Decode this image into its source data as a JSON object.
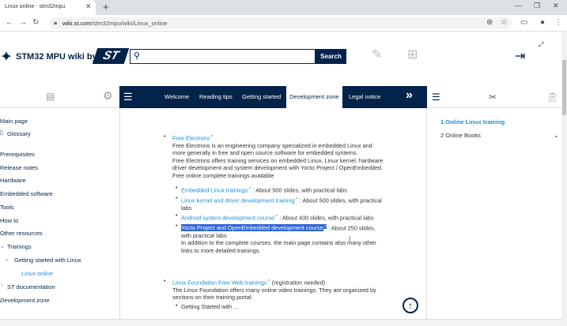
{
  "browser": {
    "tab_title": "Linux online - stm32mpu",
    "url_host": "wiki.st.com",
    "url_path": "/stm32mpu/wiki/Linux_online",
    "new_tab_icon": "plus-icon",
    "close_tab_icon": "close-icon",
    "window_controls": [
      "minimize-icon",
      "maximize-icon",
      "close-icon"
    ]
  },
  "header": {
    "logo_text": "STM32 MPU wiki by",
    "brand_mark": "ST",
    "search_placeholder": "",
    "search_button": "Search"
  },
  "left_sidebar": {
    "icons": [
      "books-icon",
      "gear-icon"
    ],
    "items": [
      {
        "label": "Main page",
        "level": 0
      },
      {
        "label": "Glossary",
        "level": 0,
        "icon": "glossary-icon"
      },
      {
        "label": "Prerequisites",
        "level": 0
      },
      {
        "label": "Release notes",
        "level": 0
      },
      {
        "label": "Hardware",
        "level": 0
      },
      {
        "label": "Embedded software",
        "level": 0
      },
      {
        "label": "Tools",
        "level": 0
      },
      {
        "label": "How to",
        "level": 0
      },
      {
        "label": "Other resources",
        "level": 0
      },
      {
        "label": "Trainings",
        "level": 1
      },
      {
        "label": "Getting started with Linux",
        "level": 2
      },
      {
        "label": "Linux online",
        "level": 3,
        "active": true
      },
      {
        "label": "ST documentation",
        "level": 1
      },
      {
        "label": "Development zone",
        "level": 0
      }
    ]
  },
  "top_nav": {
    "tabs": [
      "Welcome",
      "Reading tips",
      "Getting started",
      "Development zone",
      "Legal notice"
    ],
    "active_tab": "Development zone",
    "more_icon": "double-chevron-right-icon"
  },
  "content": {
    "fe_title": "Free Electrons",
    "fe_desc_1": "Free Electrons is an engineering company specialized in embedded Linux and",
    "fe_desc_2": "more generally in free and open source software for embedded systems.",
    "fe_desc_3": "Free Electrons offers training services on embedded Linux, Linux kernel, hardware",
    "fe_desc_4": "driver development and system development with Yocto Project / OpenEmbedded.",
    "fe_desc_5": "Free online complete trainings available",
    "t1_link": "Embedded Linux trainings",
    "t1_text": ": About 500 slides, with practical labs",
    "t2_link": "Linux kernel and driver development training",
    "t2_text": ": About 500 slides, with practical",
    "t2_text_2": "labs",
    "t3_link": "Android system development course",
    "t3_text": ": About 400 slides, with practical labs",
    "t4_link": "Yocto Project and OpenEmbedded development course",
    "t4_text": ": About 250 slides,",
    "t4_text_2": "with practical labs",
    "t4_note_1": "In addition to the complete courses, the main page contains also many other",
    "t4_note_2": "links to more detailed trainings.",
    "lf_link": "Linux Foundation Free Web trainings",
    "lf_text": "(registration needed)",
    "lf_desc_1": "The Linux Foundation offers many online video trainings. They are organized by",
    "lf_desc_2": "sections on their training portal:",
    "lf_item_1": "Getting Started with ...",
    "back_to_top_icon": "arrow-up-circle-icon"
  },
  "right_sidebar": {
    "icons": [
      "toc-list-icon",
      "tools-icon",
      "clipboard-icon"
    ],
    "toc": [
      {
        "label": "1 Online Linux training",
        "active": true
      },
      {
        "label": "2 Online Books",
        "active": false
      }
    ]
  }
}
